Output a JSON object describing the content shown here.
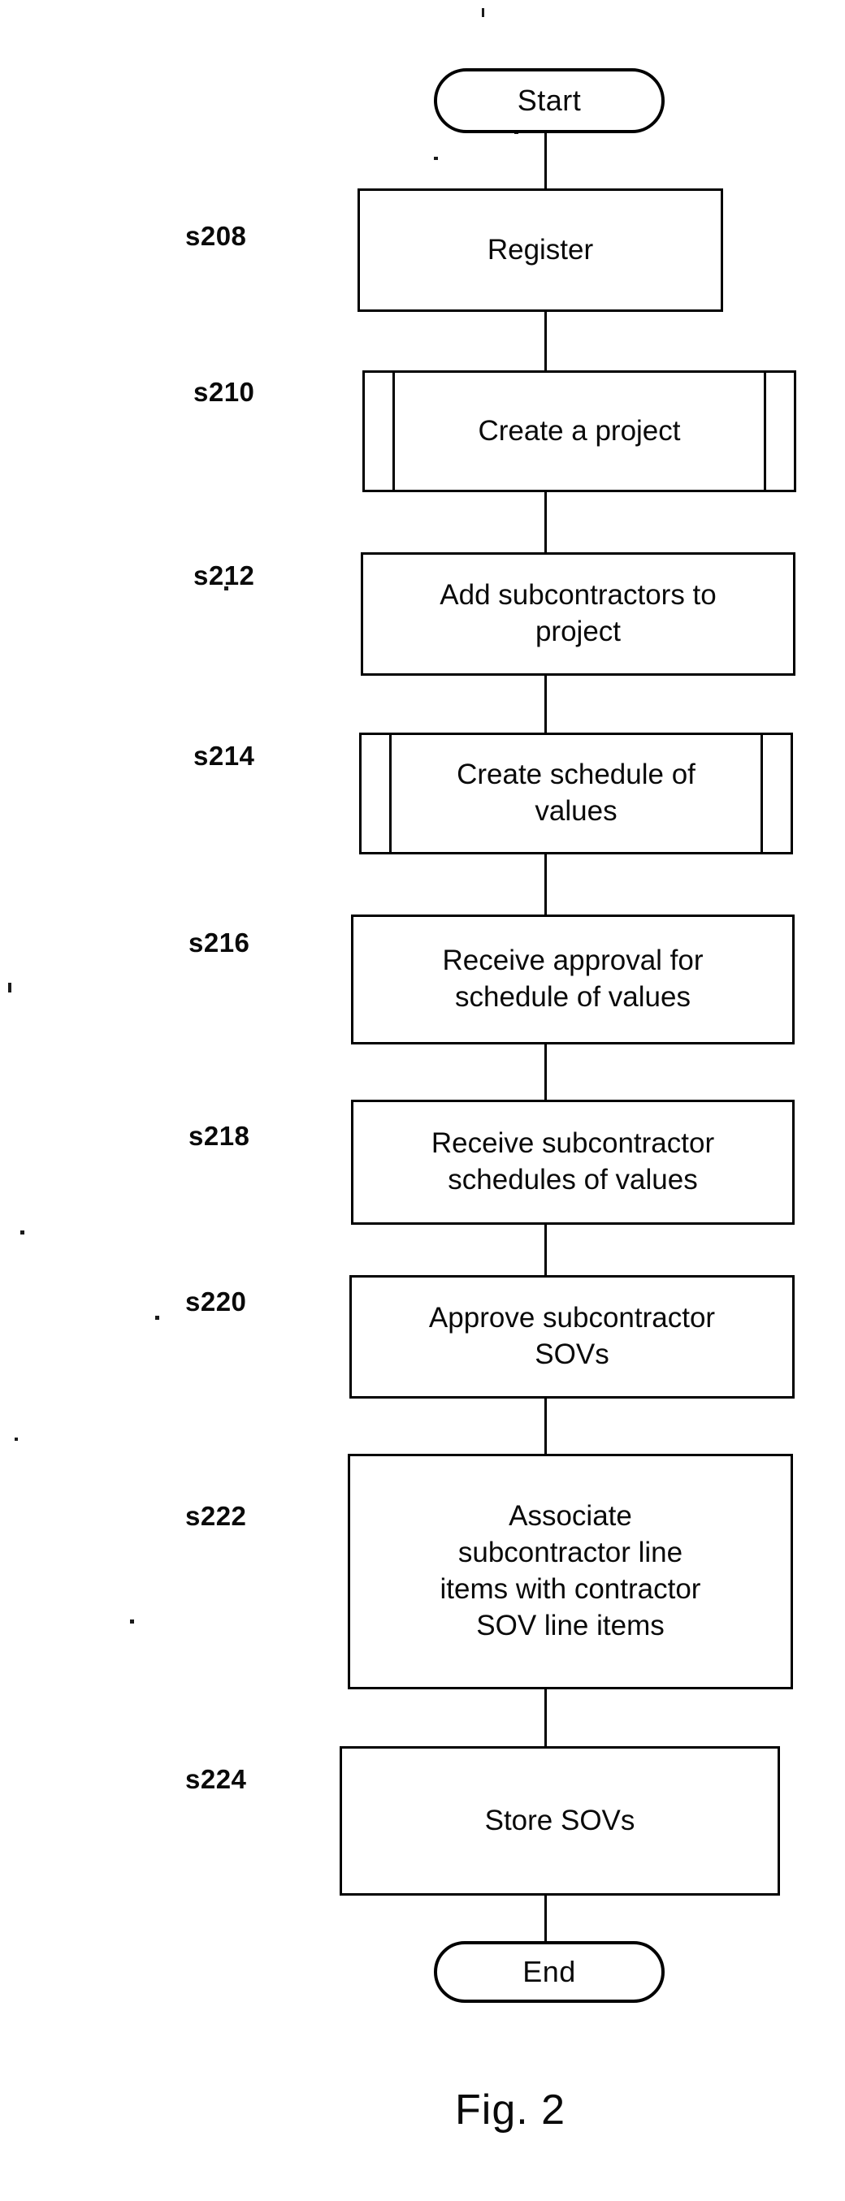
{
  "figure": {
    "caption": "Fig. 2",
    "type": "flowchart"
  },
  "chart_data": {
    "type": "diagram",
    "title": "Fig. 2",
    "orientation": "top-to-bottom",
    "nodes": [
      {
        "id": "start",
        "shape": "terminator",
        "label": "Start",
        "ref": ""
      },
      {
        "id": "s208",
        "shape": "process",
        "label": "Register",
        "ref": "s208"
      },
      {
        "id": "s210",
        "shape": "subroutine",
        "label": "Create a project",
        "ref": "s210"
      },
      {
        "id": "s212",
        "shape": "process",
        "label": "Add subcontractors to\nproject",
        "ref": "s212"
      },
      {
        "id": "s214",
        "shape": "subroutine",
        "label": "Create schedule of\nvalues",
        "ref": "s214"
      },
      {
        "id": "s216",
        "shape": "process",
        "label": "Receive approval for\nschedule of values",
        "ref": "s216"
      },
      {
        "id": "s218",
        "shape": "process",
        "label": "Receive subcontractor\nschedules of values",
        "ref": "s218"
      },
      {
        "id": "s220",
        "shape": "process",
        "label": "Approve subcontractor\nSOVs",
        "ref": "s220"
      },
      {
        "id": "s222",
        "shape": "process",
        "label": "Associate\nsubcontractor line\nitems with contractor\nSOV line items",
        "ref": "s222"
      },
      {
        "id": "s224",
        "shape": "process",
        "label": "Store SOVs",
        "ref": "s224"
      },
      {
        "id": "end",
        "shape": "terminator",
        "label": "End",
        "ref": ""
      }
    ],
    "edges": [
      {
        "from": "start",
        "to": "s208"
      },
      {
        "from": "s208",
        "to": "s210"
      },
      {
        "from": "s210",
        "to": "s212"
      },
      {
        "from": "s212",
        "to": "s214"
      },
      {
        "from": "s214",
        "to": "s216"
      },
      {
        "from": "s216",
        "to": "s218"
      },
      {
        "from": "s218",
        "to": "s220"
      },
      {
        "from": "s220",
        "to": "s222"
      },
      {
        "from": "s222",
        "to": "s224"
      },
      {
        "from": "s224",
        "to": "end"
      }
    ],
    "colors": {
      "stroke": "#000000",
      "fill": "#ffffff",
      "text": "#0a0a0a"
    }
  },
  "labels": {
    "start": "Start",
    "end": "End",
    "s208_ref": "s208",
    "s208_text": "Register",
    "s210_ref": "s210",
    "s210_text": "Create a project",
    "s212_ref": "s212",
    "s212_text": "Add subcontractors to\nproject",
    "s214_ref": "s214",
    "s214_text": "Create schedule of\nvalues",
    "s216_ref": "s216",
    "s216_text": "Receive approval for\nschedule of values",
    "s218_ref": "s218",
    "s218_text": "Receive subcontractor\nschedules of values",
    "s220_ref": "s220",
    "s220_text": "Approve subcontractor\nSOVs",
    "s222_ref": "s222",
    "s222_text": "Associate\nsubcontractor line\nitems with contractor\nSOV line items",
    "s224_ref": "s224",
    "s224_text": "Store SOVs",
    "caption": "Fig. 2"
  }
}
